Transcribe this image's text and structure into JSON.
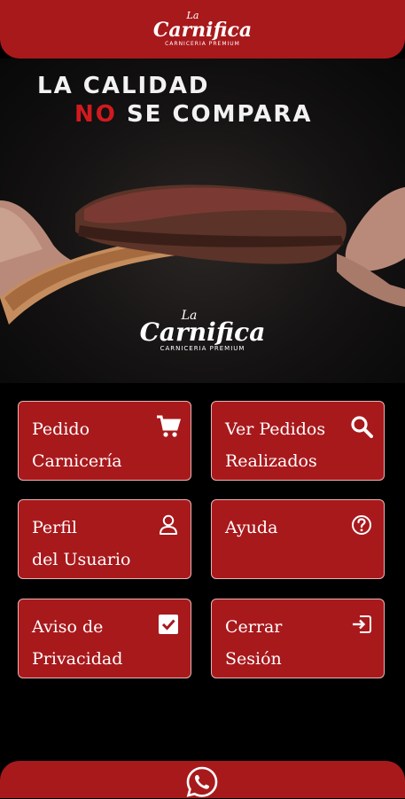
{
  "header": {
    "logo": {
      "la": "La",
      "name": "Carnifica",
      "tagline": "CARNICERIA PREMIUM"
    }
  },
  "banner": {
    "headline_line1": "LA CALIDAD",
    "headline_no": "NO",
    "headline_rest": "SE COMPARA",
    "logo": {
      "la": "La",
      "name": "Carnifica",
      "tagline": "CARNICERIA PREMIUM"
    }
  },
  "tiles": [
    {
      "line1": "Pedido",
      "line2": "Carnicería",
      "icon": "cart-icon"
    },
    {
      "line1": "Ver Pedidos",
      "line2": "Realizados",
      "icon": "search-icon"
    },
    {
      "line1": "Perfil",
      "line2": "del Usuario",
      "icon": "user-icon"
    },
    {
      "line1": "Ayuda",
      "line2": "",
      "icon": "help-circle-icon"
    },
    {
      "line1": "Aviso de",
      "line2": "Privacidad",
      "icon": "checkbox-checked-icon"
    },
    {
      "line1": "Cerrar",
      "line2": "Sesión",
      "icon": "sign-out-icon"
    }
  ],
  "footer": {
    "icon": "whatsapp-icon"
  },
  "colors": {
    "brand": "#a8191c",
    "accent_red": "#d11a1e",
    "background": "#000000"
  }
}
